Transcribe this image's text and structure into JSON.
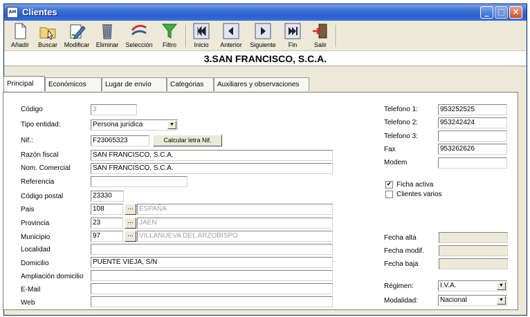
{
  "window": {
    "title": "Clientes",
    "app_icon": "AM"
  },
  "toolbar": {
    "items": [
      {
        "label": "Añadir",
        "icon": "new-document-icon"
      },
      {
        "label": "Buscar",
        "icon": "search-folder-icon"
      },
      {
        "label": "Modificar",
        "icon": "edit-pencil-icon"
      },
      {
        "label": "Eliminar",
        "icon": "trash-bin-icon"
      },
      {
        "label": "Selección",
        "icon": "selection-icon"
      },
      {
        "label": "Filtro",
        "icon": "filter-funnel-icon"
      },
      {
        "label": "Inicio",
        "icon": "first-record-icon"
      },
      {
        "label": "Anterior",
        "icon": "previous-record-icon"
      },
      {
        "label": "Siguiente",
        "icon": "next-record-icon"
      },
      {
        "label": "Fin",
        "icon": "last-record-icon"
      },
      {
        "label": "Salir",
        "icon": "exit-door-icon"
      }
    ]
  },
  "record_caption": "3.SAN FRANCISCO, S.C.A.",
  "tabs": [
    "Principal",
    "Económicos",
    "Lugar de envío",
    "Categorias",
    "Auxiliares y observaciones"
  ],
  "form": {
    "codigo": {
      "label": "Código",
      "value": "3"
    },
    "tipo_entidad": {
      "label": "Tipo entidad:",
      "value": "Persona jurídica"
    },
    "nif": {
      "label": "Nif.:",
      "value": "F23065323",
      "button": "Calcular letra Nif."
    },
    "razon_fiscal": {
      "label": "Razón fiscal",
      "value": "SAN FRANCISCO, S.C.A."
    },
    "nom_comercial": {
      "label": "Nom. Comercial",
      "value": "SAN FRANCISCO, S.C.A."
    },
    "referencia": {
      "label": "Referencia",
      "value": ""
    },
    "codigo_postal": {
      "label": "Código postal",
      "value": "23330"
    },
    "pais": {
      "label": "Pais",
      "code": "108",
      "name": "ESPAÑA"
    },
    "provincia": {
      "label": "Provincia",
      "code": "23",
      "name": "JAEN"
    },
    "municipio": {
      "label": "Municipio",
      "code": "97",
      "name": "VILLANUEVA DEL ARZOBISPO"
    },
    "localidad": {
      "label": "Localidad",
      "value": ""
    },
    "domicilio": {
      "label": "Domicilio",
      "value": "PUENTE VIEJA, S/N"
    },
    "ampliacion_domicilio": {
      "label": "Ampliación domicilio",
      "value": ""
    },
    "email": {
      "label": "E-Mail",
      "value": ""
    },
    "web": {
      "label": "Web",
      "value": ""
    },
    "ellipsis": "..."
  },
  "side": {
    "telefono1": {
      "label": "Telefono 1:",
      "value": "953252525"
    },
    "telefono2": {
      "label": "Telefono 2:",
      "value": "953242424"
    },
    "telefono3": {
      "label": "Telefono 3:",
      "value": ""
    },
    "fax": {
      "label": "Fax",
      "value": "953262626"
    },
    "modem": {
      "label": "Modem",
      "value": ""
    },
    "ficha_activa": {
      "label": "Ficha activa",
      "checked": true,
      "mark": "✔"
    },
    "clientes_varios": {
      "label": "Clientes varios",
      "checked": false
    },
    "fecha_alta": {
      "label": "Fecha alta",
      "value": ""
    },
    "fecha_modif": {
      "label": "Fecha modif.",
      "value": ""
    },
    "fecha_baja": {
      "label": "Fecha baja",
      "value": ""
    },
    "regimen": {
      "label": "Régimen:",
      "value": "I.V.A."
    },
    "modalidad": {
      "label": "Modalidad:",
      "value": "Nacional"
    }
  }
}
